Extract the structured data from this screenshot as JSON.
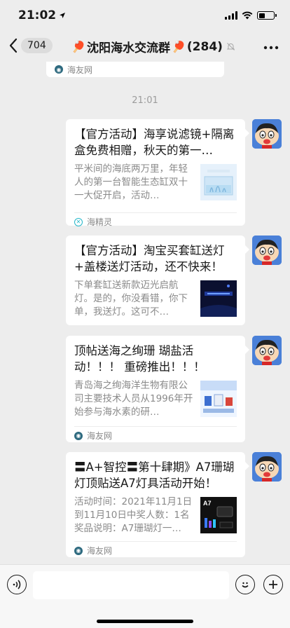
{
  "status": {
    "time": "21:02",
    "location_icon": "location-arrow-icon",
    "battery_level": 0.4
  },
  "nav": {
    "unread_count": "704",
    "title_prefix": "🏓",
    "title_name": "沈阳海水交流群",
    "title_suffix": "🏓",
    "member_count": "(284)",
    "mute_icon": "mute-bell-icon",
    "more_icon": "more-dots-icon"
  },
  "chat": {
    "partial_card_source": "海友网",
    "timestamp": "21:01",
    "messages": [
      {
        "title": "【官方活动】海享说滤镜+隔离盒免费相赠，秋天的第一…",
        "desc": "平米间的海底两万里，年轻人的第一台智能生态缸双十一大促开启，活动…",
        "source": "海精灵",
        "source_icon": "haijingling-logo-icon",
        "thumb": "aquarium-tank-image"
      },
      {
        "title": "【官方活动】淘宝买套缸送灯+盖楼送灯活动，还不快来！",
        "desc": "下单套缸送新款迈光启航灯。是的，你没看错，你下单，我送灯。这可不…",
        "source": "",
        "thumb": "dark-banner-image"
      },
      {
        "title": "顶帖送海之绚珊 瑚盐活动！！！ 重磅推出！！！",
        "desc": "青岛海之绚海洋生物有限公司主要技术人员从1996年开始参与海水素的研…",
        "source": "海友网",
        "source_icon": "haiyouwang-logo-icon",
        "thumb": "salt-products-image"
      },
      {
        "title": "〓A+智控〓第十肆期》A7珊瑚灯顶贴送A7灯具活动开始！",
        "desc": "活动时间：2021年11月1日到11月10日中奖人数：1名奖品说明：A7珊瑚灯一…",
        "source": "海友网",
        "source_icon": "haiyouwang-logo-icon",
        "thumb": "a7-lamp-image",
        "thumb_label": "A7"
      }
    ]
  },
  "input_bar": {
    "voice_icon": "voice-icon",
    "emoji_icon": "emoji-icon",
    "plus_icon": "plus-icon",
    "input_value": ""
  },
  "colors": {
    "background": "#ededed",
    "card": "#ffffff",
    "avatar_bg": "#4a80d8"
  }
}
